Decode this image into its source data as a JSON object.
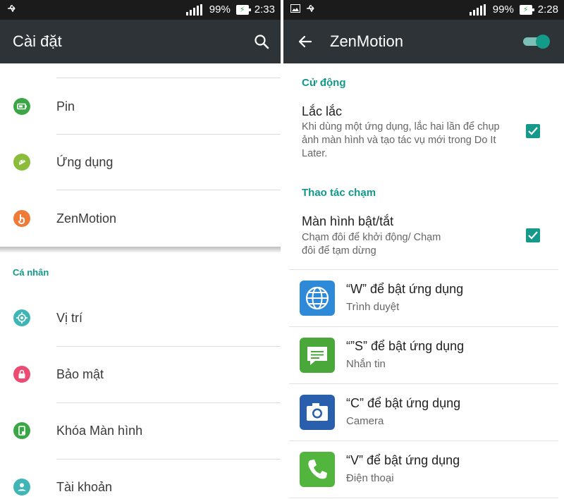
{
  "left": {
    "status": {
      "battery": "99%",
      "time": "2:33"
    },
    "title": "Cài đặt",
    "items": [
      {
        "label": "Pin",
        "icon": "battery-icon",
        "color": "#3aa645"
      },
      {
        "label": "Ứng dụng",
        "icon": "android-icon",
        "color": "#8bbd3a"
      },
      {
        "label": "ZenMotion",
        "icon": "touch-icon",
        "color": "#ef7b39"
      }
    ],
    "section": "Cá nhân",
    "personal_items": [
      {
        "label": "Vị trí",
        "icon": "location-icon",
        "color": "#3fb6b5"
      },
      {
        "label": "Bảo mật",
        "icon": "lock-icon",
        "color": "#ec4b72"
      },
      {
        "label": "Khóa Màn hình",
        "icon": "lock-screen-icon",
        "color": "#3aa645"
      },
      {
        "label": "Tài khoản",
        "icon": "account-icon",
        "color": "#3fb6b5"
      }
    ]
  },
  "right": {
    "status": {
      "battery": "99%",
      "time": "2:28"
    },
    "title": "ZenMotion",
    "toggle_on": true,
    "sections": [
      {
        "header": "Cử động",
        "title": "Lắc lắc",
        "desc": "Khi dùng một ứng dụng, lắc hai lần để chụp ảnh màn hình và tạo tác vụ mới trong Do It Later.",
        "checked": true
      },
      {
        "header": "Thao tác chạm",
        "title": "Màn hình bật/tắt",
        "desc": "Chạm đôi để khởi động/ Chạm đôi để tạm dừng",
        "checked": true
      }
    ],
    "gestures": [
      {
        "title": "“W” để bật ứng dụng",
        "app": "Trình duyệt",
        "icon": "browser-icon"
      },
      {
        "title": "“”S” để bật ứng dụng",
        "app": "Nhắn tin",
        "icon": "messaging-icon"
      },
      {
        "title": "“C” để bật ứng dụng",
        "app": "Camera",
        "icon": "camera-icon"
      },
      {
        "title": "“V” để bật ứng dụng",
        "app": "Điện thoại",
        "icon": "phone-icon"
      }
    ],
    "accent": "#12988a"
  }
}
